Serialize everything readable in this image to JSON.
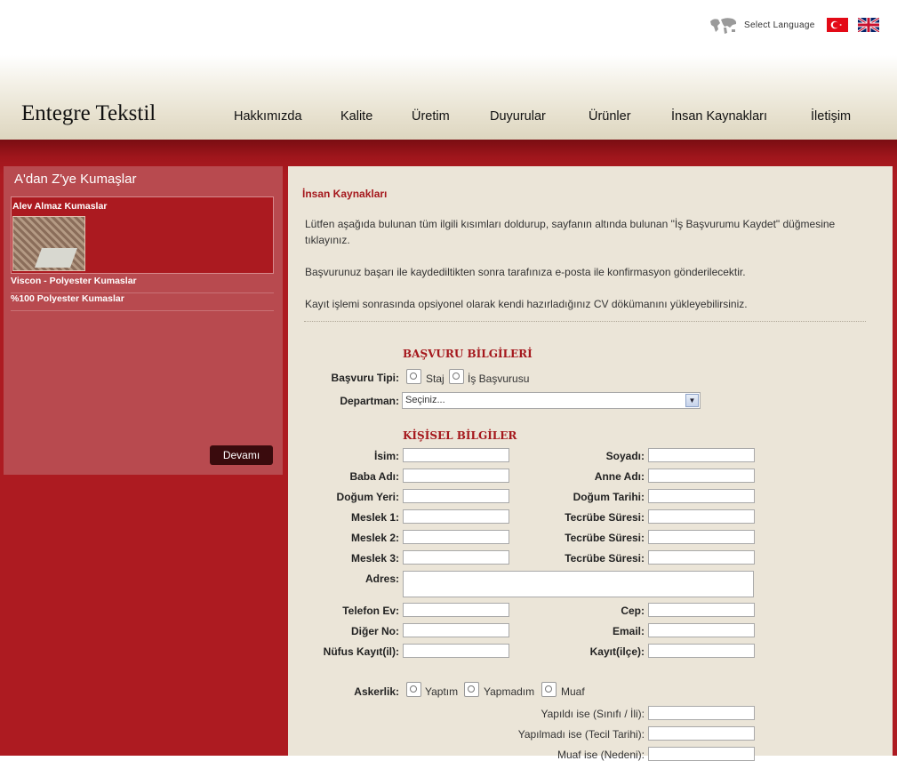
{
  "header": {
    "logo": "Entegre Tekstil",
    "language": {
      "label": "Select Language",
      "flags": [
        "turkish-flag-icon",
        "uk-flag-icon"
      ]
    },
    "nav": [
      "Hakkımızda",
      "Kalite",
      "Üretim",
      "Duyurular",
      "Ürünler",
      "İnsan Kaynakları",
      "İletişim"
    ]
  },
  "sidebar": {
    "title": "A'dan Z'ye Kumaşlar",
    "featured": "Alev Almaz Kumaslar",
    "links": [
      "Viscon - Polyester Kumaslar",
      "%100 Polyester Kumaslar"
    ],
    "more_button": "Devamı"
  },
  "main": {
    "title": "İnsan Kaynakları",
    "intro": [
      "Lütfen aşağıda bulunan tüm ilgili kısımları doldurup, sayfanın altında bulunan \"İş Başvurumu Kaydet\" düğmesine tıklayınız.",
      "Başvurunuz başarı ile kaydediltikten sonra tarafınıza e-posta ile konfirmasyon gönderilecektir.",
      "Kayıt işlemi sonrasında opsiyonel olarak kendi hazırladığınız CV dökümanını yükleyebilirsiniz."
    ],
    "application": {
      "section_title": "BAŞVURU BİLGİLERİ",
      "type_label": "Başvuru Tipi:",
      "type_options": [
        "Staj",
        "İş Başvurusu"
      ],
      "department_label": "Departman:",
      "department_value": "Seçiniz..."
    },
    "personal": {
      "section_title": "KİŞİSEL BİLGİLER",
      "left_labels": [
        "İsim:",
        "Baba Adı:",
        "Doğum Yeri:",
        "Meslek 1:",
        "Meslek 2:",
        "Meslek 3:"
      ],
      "right_labels": [
        "Soyadı:",
        "Anne Adı:",
        "Doğum Tarihi:",
        "Tecrübe Süresi:",
        "Tecrübe Süresi:",
        "Tecrübe Süresi:"
      ],
      "address_label": "Adres:",
      "contact_left": [
        "Telefon Ev:",
        "Diğer No:",
        "Nüfus Kayıt(il):"
      ],
      "contact_right": [
        "Cep:",
        "Email:",
        "Kayıt(ilçe):"
      ],
      "military_label": "Askerlik:",
      "military_options": [
        "Yaptım",
        "Yapmadım",
        "Muaf"
      ],
      "military_details": [
        "Yapıldı ise (Sınıfı / İli):",
        "Yapılmadı ise (Tecil Tarihi):",
        "Muaf ise (Nedeni):"
      ]
    }
  }
}
